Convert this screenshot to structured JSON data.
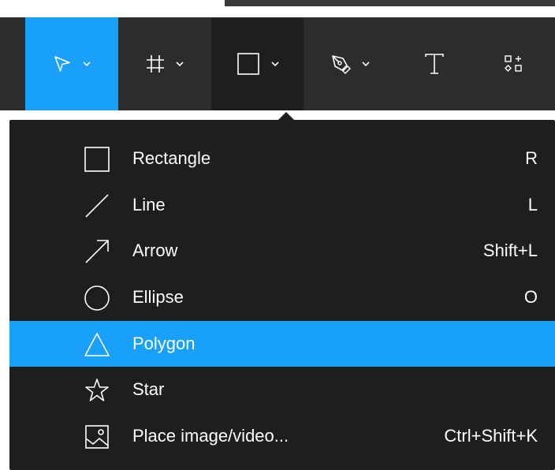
{
  "colors": {
    "toolbar_bg": "#2c2c2c",
    "menu_bg": "#1e1e1e",
    "accent": "#18a0fb",
    "icon": "#ffffff"
  },
  "toolbar": {
    "tools": [
      {
        "name": "move-tool",
        "icon": "cursor-arrow-icon",
        "has_dropdown": true,
        "active": true
      },
      {
        "name": "frame-tool",
        "icon": "frame-hash-icon",
        "has_dropdown": true,
        "active": false
      },
      {
        "name": "shape-tool",
        "icon": "square-icon",
        "has_dropdown": true,
        "active": false,
        "open": true
      },
      {
        "name": "pen-tool",
        "icon": "pen-nib-icon",
        "has_dropdown": true,
        "active": false
      },
      {
        "name": "text-tool",
        "icon": "text-t-icon",
        "has_dropdown": false,
        "active": false
      },
      {
        "name": "resources-tool",
        "icon": "resources-grid-icon",
        "has_dropdown": false,
        "active": false
      }
    ]
  },
  "menu": {
    "items": [
      {
        "label": "Rectangle",
        "shortcut": "R",
        "icon": "rectangle-icon"
      },
      {
        "label": "Line",
        "shortcut": "L",
        "icon": "line-icon"
      },
      {
        "label": "Arrow",
        "shortcut": "Shift+L",
        "icon": "arrow-icon"
      },
      {
        "label": "Ellipse",
        "shortcut": "O",
        "icon": "ellipse-icon"
      },
      {
        "label": "Polygon",
        "shortcut": "",
        "icon": "polygon-icon",
        "highlighted": true
      },
      {
        "label": "Star",
        "shortcut": "",
        "icon": "star-icon"
      },
      {
        "label": "Place image/video...",
        "shortcut": "Ctrl+Shift+K",
        "icon": "image-icon"
      }
    ]
  }
}
